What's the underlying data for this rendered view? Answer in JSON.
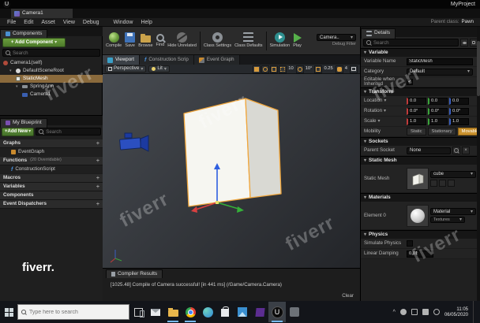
{
  "os": {
    "project_name": "MyProject",
    "taskbar": {
      "search_placeholder": "Type here to search",
      "time": "11:05",
      "date": "06/05/2020"
    }
  },
  "window": {
    "tab_title": "Camera1",
    "parent_class_label": "Parent class:",
    "parent_class_value": "Pawn"
  },
  "menu": {
    "items": [
      "File",
      "Edit",
      "Asset",
      "View",
      "Debug",
      "Window",
      "Help"
    ]
  },
  "toolbar": {
    "buttons": [
      "Compile",
      "Save",
      "Browse",
      "Find",
      "Hide Unrelated",
      "Class Settings",
      "Class Defaults",
      "Simulation",
      "Play"
    ],
    "camera_select": "Camera..",
    "debug_filter_label": "Debug Filter"
  },
  "components": {
    "title": "Components",
    "add_button_label": "+ Add Component",
    "search_placeholder": "Search",
    "tree": [
      {
        "label": "Camera1(self)"
      },
      {
        "label": "DefaultSceneRoot"
      },
      {
        "label": "StaticMesh"
      },
      {
        "label": "SpringArm"
      },
      {
        "label": "Camera1"
      }
    ]
  },
  "my_blueprint": {
    "title": "My Blueprint",
    "add_new_label": "+Add New",
    "search_placeholder": "Search",
    "rows": [
      {
        "label": "Graphs",
        "add": "+"
      },
      {
        "label": "EventGraph"
      },
      {
        "label": "Functions",
        "note": "(20 Overridable)",
        "add": "+"
      },
      {
        "label": "ConstructionScript"
      },
      {
        "label": "Macros",
        "add": "+"
      },
      {
        "label": "Variables",
        "add": "+"
      },
      {
        "label": "Components"
      },
      {
        "label": "Event Dispatchers",
        "add": "+"
      }
    ]
  },
  "viewport": {
    "tabs": [
      "Viewport",
      "Construction Scrip",
      "Event Graph"
    ],
    "perspective_label": "Perspective",
    "lit_label": "Lit",
    "snap_move": "10",
    "snap_rotate": "10°",
    "snap_scale": "0.25",
    "camera_speed": "4"
  },
  "compiler": {
    "title": "Compiler Results",
    "message": "[1025.48] Compile of Camera successful! [in 441 ms] (/Game/Camera.Camera)",
    "clear_label": "Clear"
  },
  "details": {
    "title": "Details",
    "search_placeholder": "Search",
    "variable": {
      "title": "Variable",
      "name_label": "Variable Name",
      "name_value": "StaticMesh",
      "category_label": "Category",
      "category_value": "Default",
      "editable_label": "Editable when Inherited"
    },
    "transform": {
      "title": "Transform",
      "location_label": "Location",
      "rotation_label": "Rotation",
      "scale_label": "Scale",
      "location": [
        "0.0",
        "0.0",
        "0.0"
      ],
      "rotation": [
        "0.0°",
        "0.0°",
        "0.0°"
      ],
      "scale": [
        "1.0",
        "1.0",
        "1.0"
      ],
      "mobility_label": "Mobility",
      "mobility_options": [
        "Static",
        "Stationary",
        "Movable"
      ],
      "mobility_selected": "Movable"
    },
    "sockets": {
      "title": "Sockets",
      "parent_socket_label": "Parent Socket",
      "parent_socket_value": "None"
    },
    "static_mesh": {
      "title": "Static Mesh",
      "row_label": "Static Mesh",
      "mesh_value": "cube"
    },
    "materials": {
      "title": "Materials",
      "element_label": "Element 0",
      "material_value": "Material",
      "textures_label": "Textures"
    },
    "physics": {
      "title": "Physics",
      "simulate_label": "Simulate Physics",
      "damping_label": "Linear Damping",
      "damping_value": "0.01"
    }
  },
  "watermark": {
    "tile_text": "fiverr",
    "logo_text": "fiverr."
  },
  "icons": {
    "caret_down": "▾",
    "plus": "+",
    "check": "✓",
    "close": "×",
    "chevron_up": "^",
    "ue_logo": "U",
    "function_glyph": "f"
  }
}
